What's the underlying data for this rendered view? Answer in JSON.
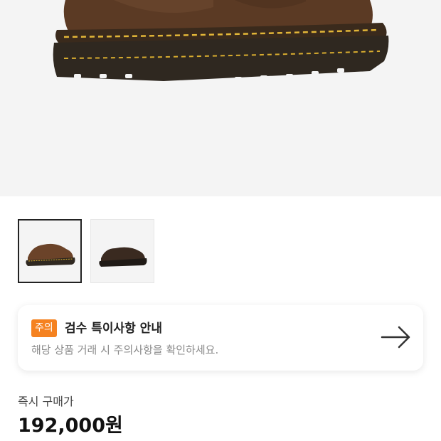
{
  "gallery": {
    "main_image": "brown-leather-derby-shoe",
    "thumbnails": [
      {
        "name": "brown-leather-derby-shoe",
        "selected": true
      },
      {
        "name": "dark-brown-derby-shoe",
        "selected": false
      }
    ]
  },
  "notice": {
    "badge": "주의",
    "title": "검수 특이사항 안내",
    "description": "해당 상품 거래 시 주의사항을 확인하세요.",
    "arrow_icon": "arrow-right-icon"
  },
  "price": {
    "label": "즉시 구매가",
    "value": "192,000원"
  },
  "colors": {
    "badge": "#f58220",
    "background_image": "#f4f4f4"
  }
}
